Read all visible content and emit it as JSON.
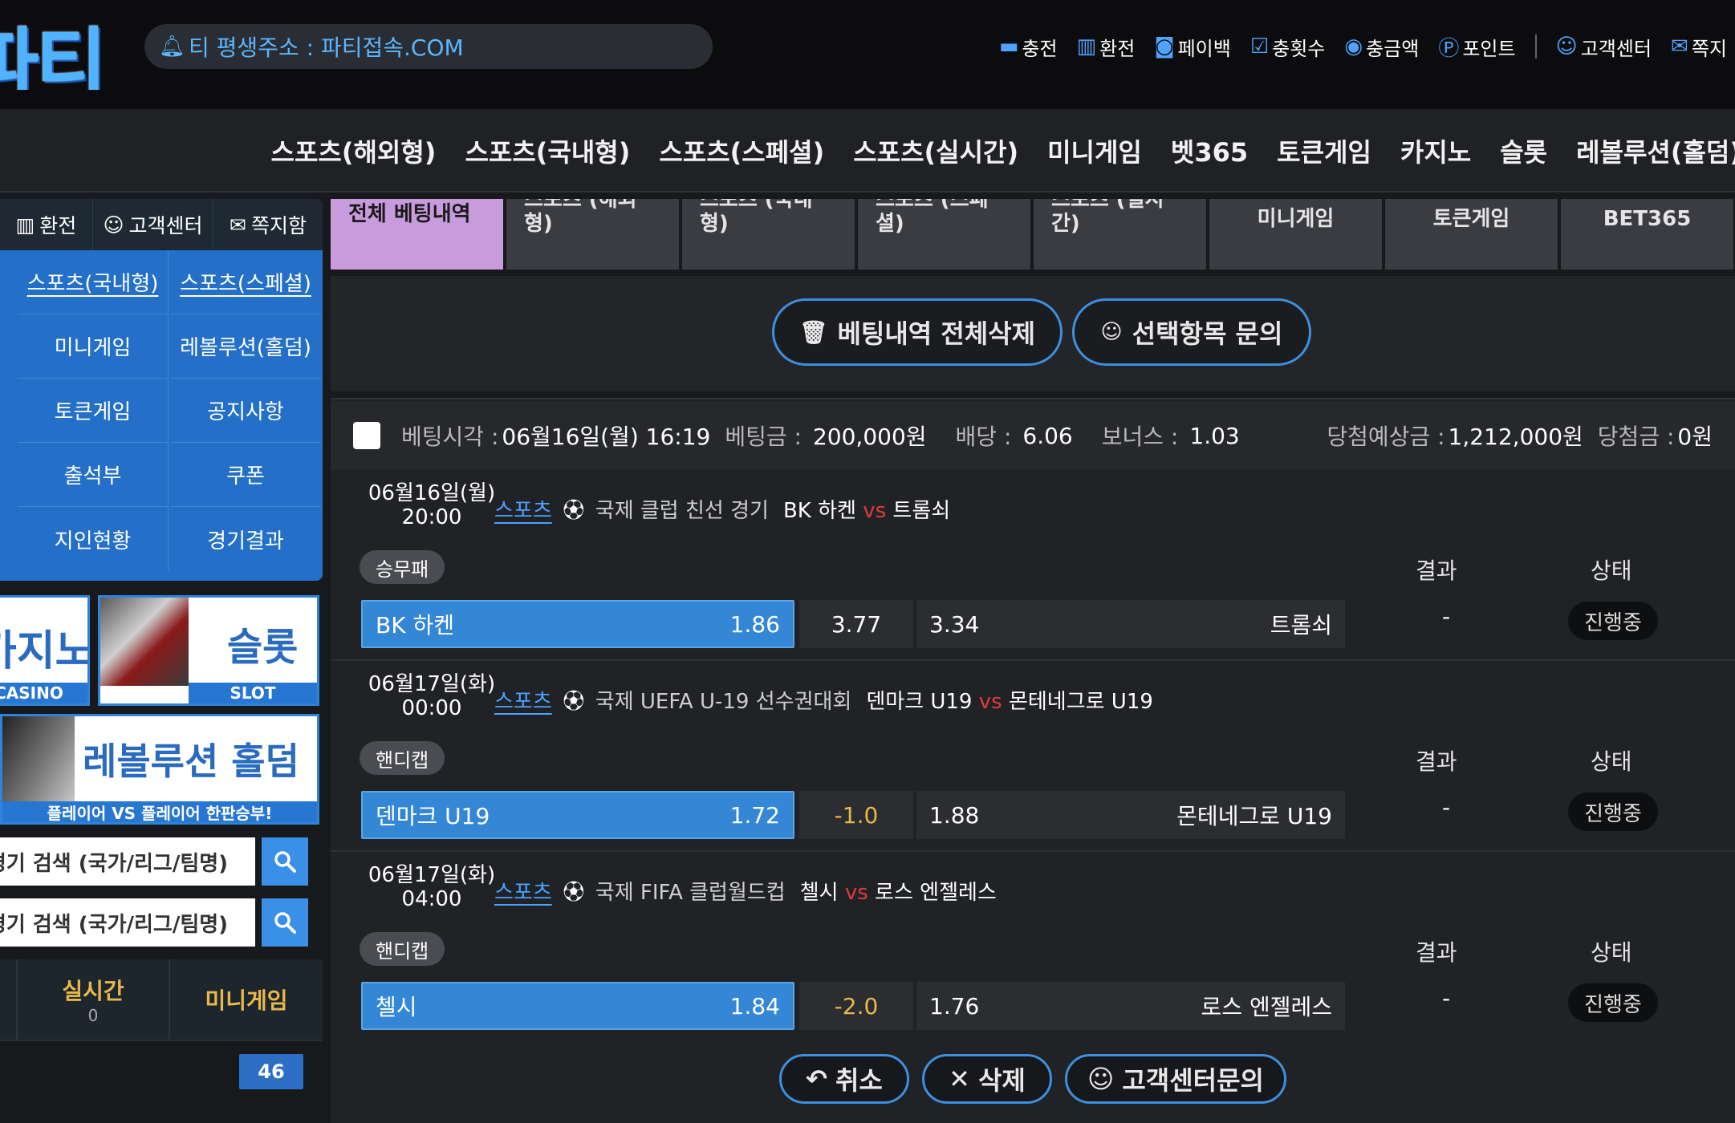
{
  "logo": {
    "text": "파티"
  },
  "address": {
    "text": "티 평생주소 : 파티접속.COM"
  },
  "topmenu": [
    {
      "icon": "card-icon",
      "glyph": "▬",
      "label": "충전"
    },
    {
      "icon": "atm-icon",
      "glyph": "▥",
      "label": "환전"
    },
    {
      "icon": "cash-icon",
      "glyph": "◙",
      "label": "페이백"
    },
    {
      "icon": "check-icon",
      "glyph": "☑",
      "label": "충횟수"
    },
    {
      "icon": "coins-icon",
      "glyph": "◉",
      "label": "충금액"
    },
    {
      "icon": "point-icon",
      "glyph": "Ⓟ",
      "label": "포인트"
    },
    {
      "icon": "support-icon",
      "glyph": "☺",
      "label": "고객센터"
    },
    {
      "icon": "message-icon",
      "glyph": "✉",
      "label": "쪽지"
    }
  ],
  "nav": [
    "스포츠(해외형)",
    "스포츠(국내형)",
    "스포츠(스페셜)",
    "스포츠(실시간)",
    "미니게임",
    "벳365",
    "토큰게임",
    "카지노",
    "슬롯",
    "레볼루션(홀덤)"
  ],
  "sidebar": {
    "top": [
      {
        "icon": "atm-icon",
        "glyph": "▥",
        "label": "환전"
      },
      {
        "icon": "support-icon",
        "glyph": "☺",
        "label": "고객센터"
      },
      {
        "icon": "message-icon",
        "glyph": "✉",
        "label": "쪽지함"
      }
    ],
    "grid": [
      {
        "label": "스포츠(국내형)",
        "u": true
      },
      {
        "label": "스포츠(스페셜)",
        "u": true
      },
      {
        "label": "미니게임"
      },
      {
        "label": "레볼루션(홀덤)"
      },
      {
        "label": "토큰게임"
      },
      {
        "label": "공지사항"
      },
      {
        "label": "출석부"
      },
      {
        "label": "쿠폰"
      },
      {
        "label": "지인현황"
      },
      {
        "label": "경기결과"
      }
    ],
    "banners": {
      "casino_big": "카지노",
      "casino_small": "CASINO",
      "slot_big": "슬롯",
      "slot_small": "SLOT",
      "holdem_big": "레볼루션 홀덤",
      "holdem_small": "플레이어 VS 플레이어 한판승부!"
    },
    "search1": "경기 검색 (국가/리그/팀명)",
    "search2": "경기 검색 (국가/리그/팀명)",
    "tabs": [
      {
        "label": "실시간",
        "count": "0"
      },
      {
        "label": "미니게임"
      }
    ],
    "badge": "46"
  },
  "tabs": [
    "전체 베팅내역",
    "스포츠 (해외형)",
    "스포츠 (국내형)",
    "스포츠 (스페셜)",
    "스포츠 (실시간)",
    "미니게임",
    "토큰게임",
    "BET365"
  ],
  "actions": {
    "delete_all": "베팅내역 전체삭제",
    "inquiry": "선택항목 문의"
  },
  "summary": {
    "time_label": "베팅시각 :",
    "time_value": "06월16일(월) 16:19",
    "amount_label": "베팅금 :",
    "amount_value": "200,000원",
    "odds_label": "배당 :",
    "odds_value": "6.06",
    "bonus_label": "보너스 :",
    "bonus_value": "1.03",
    "expected_label": "당첨예상금 :",
    "expected_value": "1,212,000원",
    "win_label": "당첨금 :",
    "win_value": "0원"
  },
  "col_result": "결과",
  "col_status": "상태",
  "matches": [
    {
      "date": "06월16일(월)",
      "time": "20:00",
      "sport": "스포츠",
      "league": "국제 클럽 친선 경기",
      "home": "BK 하켄",
      "vs": "vs",
      "away": "트롬쇠",
      "type": "승무패",
      "home_odds": "1.86",
      "mid": "3.77",
      "away_odds": "3.34",
      "result": "-",
      "status": "진행중"
    },
    {
      "date": "06월17일(화)",
      "time": "00:00",
      "sport": "스포츠",
      "league": "국제 UEFA U-19 선수권대회",
      "home": "덴마크 U19",
      "vs": "vs",
      "away": "몬테네그로 U19",
      "type": "핸디캡",
      "home_odds": "1.72",
      "mid": "-1.0",
      "away_odds": "1.88",
      "result": "-",
      "status": "진행중"
    },
    {
      "date": "06월17일(화)",
      "time": "04:00",
      "sport": "스포츠",
      "league": "국제 FIFA 클럽월드컵",
      "home": "첼시",
      "vs": "vs",
      "away": "로스 엔젤레스",
      "type": "핸디캡",
      "home_odds": "1.84",
      "mid": "-2.0",
      "away_odds": "1.76",
      "result": "-",
      "status": "진행중"
    }
  ],
  "bottom": {
    "cancel": "취소",
    "delete": "삭제",
    "support": "고객센터문의"
  }
}
